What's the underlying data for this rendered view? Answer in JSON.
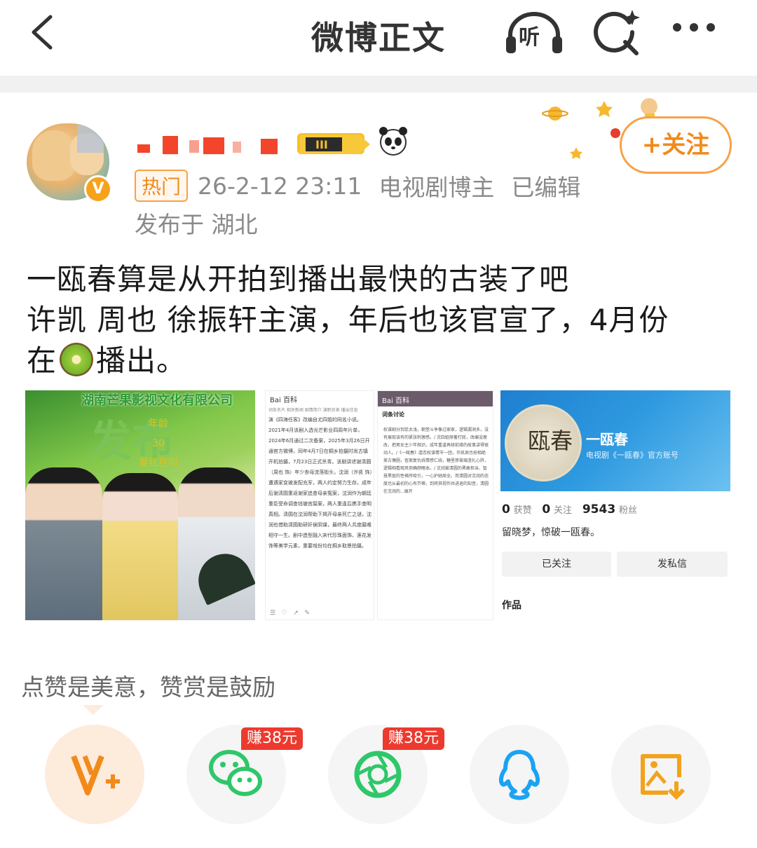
{
  "header": {
    "title": "微博正文",
    "listen_label": "听"
  },
  "post": {
    "author_name_masked": "",
    "hot_tag": "热门",
    "timestamp": "26-2-12 23:11",
    "author_role": "电视剧博主",
    "edited": "已编辑",
    "location": "发布于 湖北",
    "follow_label": "+关注",
    "text_line1": "一瓯春算是从开拍到播出最快的古装了吧",
    "text_line2": "许凯 周也 徐振轩主演，年后也该官宣了，4月份",
    "text_line3a": "在",
    "text_line3b": "播出。"
  },
  "images": {
    "img1": {
      "title": "湖南芒果影视文化有限公司",
      "big": "发布",
      "small1": "年龄",
      "small2": "30",
      "small3": "爱红豆叫"
    },
    "img2": {
      "bar": "Bai 百科",
      "tabs": "词条名片  相关新闻  剧情简介  演职员表  播出信息",
      "text": "演《四海任客》改编自尤四姐的同名小说。2021年4月该剧入选光芒影业四周年片单，2024年6月通过二次备案，2025年3月26日开通官方微博，同年4月7日在桐乡拍摄时尚古镇开机拍摄，7月23日正式杀青。该剧讲述谢清圆（周也 饰）年少丧母流落街头，沈润（许凯 饰）遭遇家变被发配充军，两人约定努力生存。成年后谢清圆重返谢家追查母亲冤案，沈润作为朝廷重臣受命调查钱塘宫腐案，两人重逢后携手查明真相。清圆在沈润帮助下揭开母亲死亡之谜，沈润也借助清圆助研奸侯阴谋，最终两人共度磨难相守一生。剧中造型融入宋代珍珠面饰、莲花发饰等美学元素，重要戏份均在桐乡取景拍摄。"
    },
    "img3": {
      "bar": "Bai 百科",
      "head": "词条讨论",
      "text": "权谋剧分到蕊太浅，朝堂斗争像过家家，逻辑漏洞多，没有展现该有的紧张刺激感。/ 沈四姐原著打底，改编没瘦改，把男女主少年相识，成年重逢再续前缘的故事讲得很动人。/《一瓯春》虐恋权谋情节一团，许凯周也扮相绝美古偶圈，查案复仇线情感仁线，糖里掺玻璃渣扎心肝，逻辑相看观风但确颜睹本。/ 沈润被清圆的勇敢担当、智慧黑驱的性格所吸引，一心护她周全。而清圆对沈润的态度也从最初的心有芥蒂，到将其视作共进退的知音，清圆在沈润的...展开"
    },
    "img4": {
      "logo": "瓯春",
      "name": "一瓯春",
      "sub": "电视剧《一瓯春》官方账号",
      "likes_num": "0",
      "likes_lbl": "获赞",
      "follow_num": "0",
      "follow_lbl": "关注",
      "fans_num": "9543",
      "fans_lbl": "粉丝",
      "bio": "留晓梦，惊破一瓯春。",
      "btn_followed": "已关注",
      "btn_message": "发私信",
      "works": "作品"
    }
  },
  "reward": {
    "text": "点赞是美意，赞赏是鼓励"
  },
  "share": [
    {
      "name": "vplus-reward",
      "icon": "v-plus-icon"
    },
    {
      "name": "wechat",
      "icon": "wechat-icon",
      "earn": "赚38元"
    },
    {
      "name": "moments",
      "icon": "moments-icon",
      "earn": "赚38元"
    },
    {
      "name": "qq",
      "icon": "qq-icon"
    },
    {
      "name": "save-image",
      "icon": "save-image-icon"
    }
  ],
  "colors": {
    "accent": "#f28a1a",
    "earn_red": "#ec3a2e",
    "wechat_green": "#2fc76a"
  }
}
